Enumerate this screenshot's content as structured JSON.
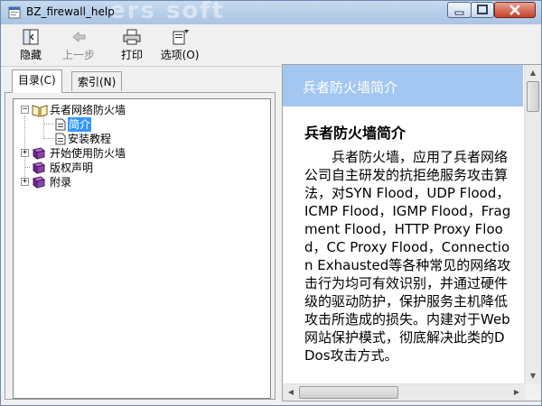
{
  "window": {
    "title": "BZ_firewall_help",
    "watermark": "ers soft"
  },
  "toolbar": {
    "hide_label": "隐藏",
    "back_label": "上一步",
    "print_label": "打印",
    "options_label": "选项(O)"
  },
  "tabs": {
    "contents_label": "目录(C)",
    "index_label": "索引(N)"
  },
  "tree": {
    "items": [
      {
        "label": "兵者网络防火墙"
      },
      {
        "label": "简介"
      },
      {
        "label": "安装教程"
      },
      {
        "label": "开始使用防火墙"
      },
      {
        "label": "版权声明"
      },
      {
        "label": "附录"
      }
    ]
  },
  "content": {
    "banner_title": "兵者防火墙简介",
    "heading": "兵者防火墙简介",
    "paragraph": "兵者防火墙，应用了兵者网络公司自主研发的抗拒绝服务攻击算法，对SYN Flood，UDP Flood，ICMP Flood，IGMP Flood，Fragment Flood，HTTP Proxy Flood，CC Proxy Flood，Connection Exhausted等各种常见的网络攻击行为均可有效识别，并通过硬件级的驱动防护，保护服务主机降低攻击所造成的损失。内建对于Web网站保护模式，彻底解决此类的DDos攻击方式。"
  },
  "colors": {
    "banner": "#a3c7f0",
    "selection": "#3399ff"
  }
}
